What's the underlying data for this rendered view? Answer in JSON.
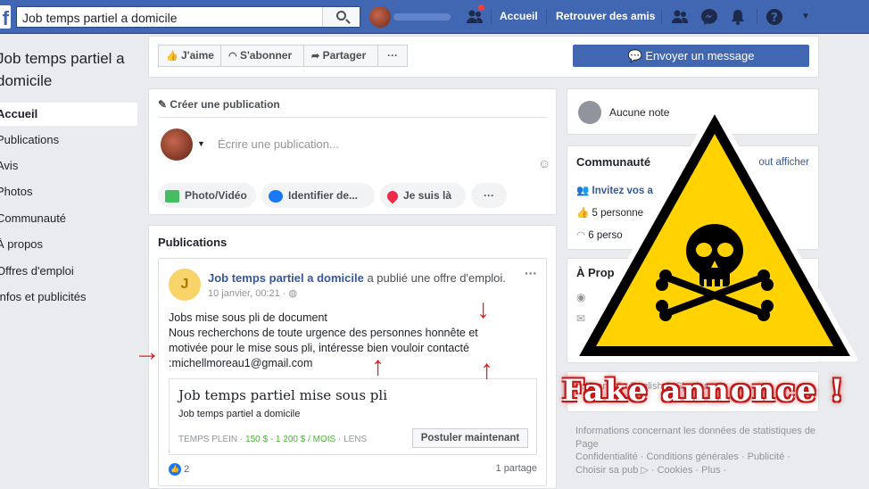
{
  "topbar": {
    "search_value": "Job temps partiel a domicile",
    "nav_home": "Accueil",
    "nav_find_friends": "Retrouver des amis"
  },
  "page": {
    "title": "Job temps partiel a domicile",
    "nav": [
      "Accueil",
      "Publications",
      "Avis",
      "Photos",
      "Communauté",
      "À propos",
      "Offres d'emploi",
      "Infos et publicités"
    ]
  },
  "actions": {
    "like": "J'aime",
    "follow": "S'abonner",
    "share": "Partager",
    "more": "···",
    "message": "Envoyer un message"
  },
  "composer": {
    "header": "Créer une publication",
    "placeholder": "Écrire une publication...",
    "photo": "Photo/Vidéo",
    "tag": "Identifier de...",
    "feeling": "Je suis là",
    "more": "···"
  },
  "publications": {
    "heading": "Publications",
    "post": {
      "avatar_letter": "J",
      "author": "Job temps partiel a domicile",
      "action_text": "a publié une offre d'emploi.",
      "date": "10 janvier, 00:21 · ",
      "body_line1": "Jobs mise sous pli de document",
      "body_line2": "Nous recherchons de toute urgence des personnes honnête et",
      "body_line3": "motivée pour le mise sous pli, intéresse bien vouloir contacté",
      "body_line4": ":michellmoreau1@gmail.com",
      "job_title": "Job temps partiel mise sous pli",
      "job_company": "Job temps partiel a domicile",
      "job_type": "TEMPS PLEIN · ",
      "job_salary": "150 $ - 1 200 $ / MOIS",
      "job_location": " · LENS",
      "apply": "Postuler maintenant",
      "reactions": "2",
      "shares": "1 partage"
    }
  },
  "right": {
    "no_note": "Aucune note",
    "community": "Communauté",
    "see_all": "out afficher",
    "invite": "Invitez vos a",
    "likes": "5 personne",
    "follows": "6 perso",
    "about": "À Prop",
    "languages": "...(France) · English (US) · Suomi",
    "info": "Informations concernant les données de statistiques de Page",
    "legal": "Confidentialité · Conditions générales · Publicité · Choisir sa pub ▷ · Cookies · Plus ·"
  },
  "overlay": {
    "fake_text": "Fake annonce !"
  },
  "colors": {
    "brand": "#4267b2",
    "warning": "#ffd200",
    "arrow": "#e02020"
  }
}
